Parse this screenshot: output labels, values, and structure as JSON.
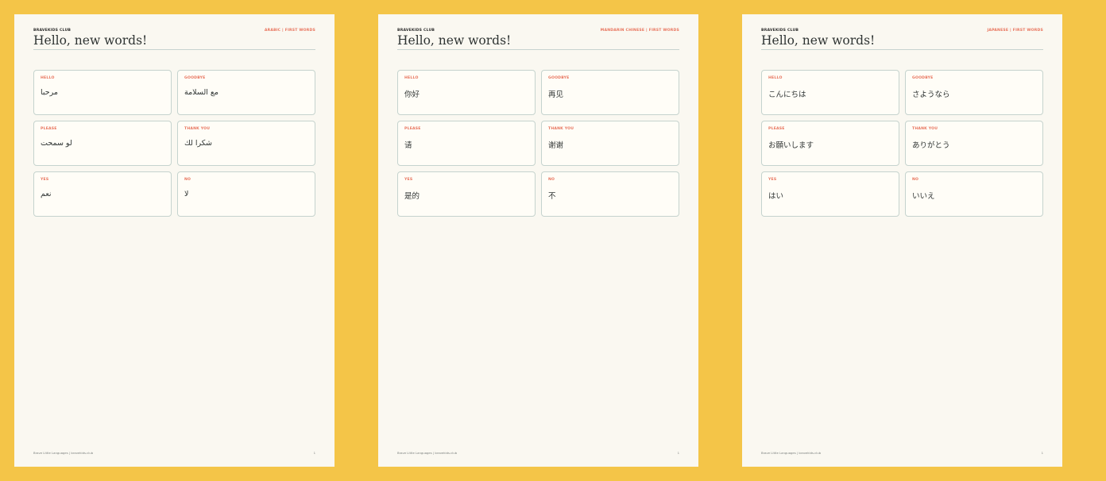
{
  "pages": [
    {
      "brand": "BRAVEKIDS CLUB",
      "tag": "ARABIC | FIRST WORDS",
      "title": "Hello, new words!",
      "cards": [
        {
          "label": "HELLO",
          "word": "مرحبا"
        },
        {
          "label": "GOODBYE",
          "word": "مع السلامة"
        },
        {
          "label": "PLEASE",
          "word": "لو سمحت"
        },
        {
          "label": "THANK YOU",
          "word": "شكرا لك"
        },
        {
          "label": "YES",
          "word": "نعم"
        },
        {
          "label": "NO",
          "word": "لا"
        }
      ],
      "footer": "Brave Little Languages | bravekids.club",
      "page_number": "1"
    },
    {
      "brand": "BRAVEKIDS CLUB",
      "tag": "MANDARIN CHINESE | FIRST WORDS",
      "title": "Hello, new words!",
      "cards": [
        {
          "label": "HELLO",
          "word": "你好"
        },
        {
          "label": "GOODBYE",
          "word": "再见"
        },
        {
          "label": "PLEASE",
          "word": "请"
        },
        {
          "label": "THANK YOU",
          "word": "谢谢"
        },
        {
          "label": "YES",
          "word": "是的"
        },
        {
          "label": "NO",
          "word": "不"
        }
      ],
      "footer": "Brave Little Languages | bravekids.club",
      "page_number": "1"
    },
    {
      "brand": "BRAVEKIDS CLUB",
      "tag": "JAPANESE | FIRST WORDS",
      "title": "Hello, new words!",
      "cards": [
        {
          "label": "HELLO",
          "word": "こんにちは"
        },
        {
          "label": "GOODBYE",
          "word": "さようなら"
        },
        {
          "label": "PLEASE",
          "word": "お願いします"
        },
        {
          "label": "THANK YOU",
          "word": "ありがとう"
        },
        {
          "label": "YES",
          "word": "はい"
        },
        {
          "label": "NO",
          "word": "いいえ"
        }
      ],
      "footer": "Brave Little Languages | bravekids.club",
      "page_number": "1"
    }
  ],
  "colors": {
    "background": "#f4c548",
    "page": "#faf8f1",
    "accent": "#e8735c",
    "text": "#2f3433",
    "card_border": "#c5d3ce"
  }
}
